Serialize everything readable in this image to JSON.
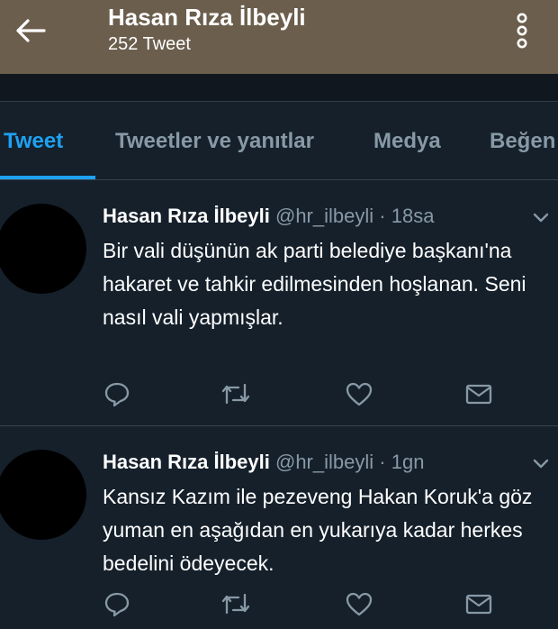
{
  "header": {
    "title": "Hasan Rıza İlbeyli",
    "subtitle": "252 Tweet"
  },
  "tabs": [
    {
      "label": "Tweet",
      "active": true
    },
    {
      "label": "Tweetler ve yanıtlar",
      "active": false
    },
    {
      "label": "Medya",
      "active": false
    },
    {
      "label": "Beğen",
      "active": false
    }
  ],
  "tweets": [
    {
      "name": "Hasan Rıza İlbeyli",
      "handle": "@hr_ilbeyli",
      "separator": "·",
      "time": "18sa",
      "text": "Bir vali düşünün ak parti belediye başkanı'na hakaret ve tahkir edilmesinden hoşlanan. Seni nasıl vali yapmışlar."
    },
    {
      "name": "Hasan Rıza İlbeyli",
      "handle": "@hr_ilbeyli",
      "separator": "·",
      "time": "1gn",
      "text": "Kansız Kazım ile pezeveng Hakan Koruk'a göz yuman en aşağıdan en yukarıya kadar herkes bedelini ödeyecek."
    }
  ],
  "icons": {
    "back": "arrow-left-icon",
    "more": "more-vertical-icon",
    "chevron": "chevron-down-icon",
    "reply": "reply-icon",
    "retweet": "retweet-icon",
    "like": "heart-icon",
    "dm": "envelope-icon"
  },
  "colors": {
    "header_bg": "#6b5e4d",
    "page_bg": "#15202b",
    "accent": "#1da1f2",
    "muted": "#8899a6",
    "divider": "#38444d"
  }
}
